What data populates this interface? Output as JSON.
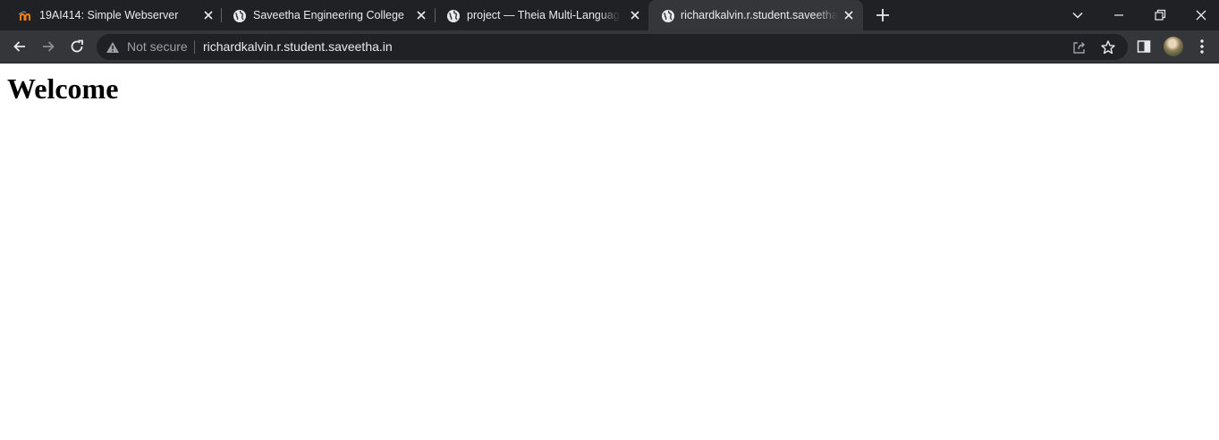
{
  "browser": {
    "tabs": [
      {
        "title": "19AI414: Simple Webserver",
        "favicon": "moodle-icon",
        "active": false
      },
      {
        "title": "Saveetha Engineering College",
        "favicon": "globe-icon",
        "active": false
      },
      {
        "title": "project — Theia Multi-Language",
        "favicon": "globe-icon",
        "active": false
      },
      {
        "title": "richardkalvin.r.student.saveetha.in",
        "favicon": "globe-icon",
        "active": true
      }
    ],
    "address_bar": {
      "security_label": "Not secure",
      "url": "richardkalvin.r.student.saveetha.in"
    },
    "colors": {
      "tabstrip": "#202124",
      "toolbar": "#35363a",
      "omnibox": "#202124",
      "text": "#e8eaed",
      "muted_text": "#9aa0a6",
      "moodle_orange": "#f98012"
    }
  },
  "page": {
    "heading": "Welcome"
  }
}
